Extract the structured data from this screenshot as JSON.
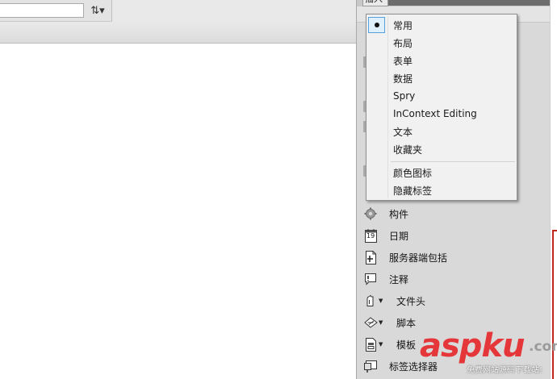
{
  "toolbar": {
    "title_value": "",
    "sort_icon": "sort-ascending-icon",
    "sort_glyph": "⇅▾"
  },
  "panel": {
    "tab_label": "插入"
  },
  "menu": {
    "items": [
      {
        "label": "常用",
        "checked": true
      },
      {
        "label": "布局"
      },
      {
        "label": "表单"
      },
      {
        "label": "数据"
      },
      {
        "label": "Spry"
      },
      {
        "label": "InContext Editing"
      },
      {
        "label": "文本"
      },
      {
        "label": "收藏夹"
      },
      {
        "label": "颜色图标"
      },
      {
        "label": "隐藏标签"
      }
    ]
  },
  "insert_items": [
    {
      "label": "构件",
      "icon": "gear-icon"
    },
    {
      "label": "日期",
      "icon": "calendar-icon",
      "icon_text": "19"
    },
    {
      "label": "服务器端包括",
      "icon": "server-include-icon"
    },
    {
      "label": "注释",
      "icon": "comment-icon"
    },
    {
      "label": "文件头",
      "icon": "document-head-icon",
      "has_dropdown": true
    },
    {
      "label": "脚本",
      "icon": "script-icon",
      "has_dropdown": true
    },
    {
      "label": "模板",
      "icon": "template-icon",
      "has_dropdown": true
    },
    {
      "label": "标签选择器",
      "icon": "tag-chooser-icon"
    }
  ],
  "watermark": {
    "main": "aspku",
    "suffix": ".com",
    "sub": "免费网站源码下载站!"
  },
  "colors": {
    "menu_check_fill": "#dfeffc",
    "menu_check_border": "#56a0de",
    "watermark_red": "#e5373a",
    "accent_red_line": "#c0271e"
  }
}
